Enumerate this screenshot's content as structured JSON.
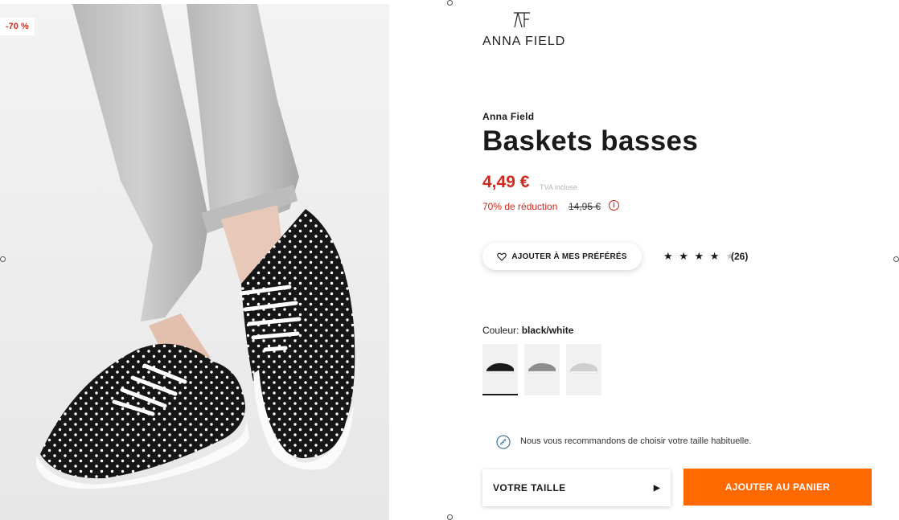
{
  "badge": {
    "discount": "-70 %"
  },
  "logo": {
    "text": "ANNA FIELD"
  },
  "product": {
    "brand": "Anna Field",
    "title": "Baskets basses",
    "price": "4,49 €",
    "vat_note": "TVA incluse",
    "discount_text": "70% de réduction",
    "original_price": "14,95 €",
    "info_glyph": "i"
  },
  "wishlist": {
    "label": "AJOUTER À MES PRÉFÉRÉS",
    "icon": "heart-outline-icon"
  },
  "rating": {
    "stars_filled": "★ ★ ★ ★",
    "star_empty": "★",
    "value": 4,
    "max": 5,
    "reviews": "(26)"
  },
  "colour": {
    "label": "Couleur:",
    "selected": "black/white",
    "swatches": [
      {
        "name": "black/white",
        "color": "#1a1a1a",
        "selected": true
      },
      {
        "name": "grey",
        "color": "#8d8d8d",
        "selected": false
      },
      {
        "name": "white/grey",
        "color": "#cfcfcf",
        "selected": false
      }
    ]
  },
  "fit": {
    "text": "Nous vous recommandons de choisir votre taille habituelle.",
    "icon": "size-fit-icon"
  },
  "size": {
    "label": "VOTRE TAILLE",
    "arrow": "▶"
  },
  "cart": {
    "label": "AJOUTER AU PANIER"
  },
  "colors": {
    "accent": "#ff6900",
    "sale": "#d2281c"
  }
}
